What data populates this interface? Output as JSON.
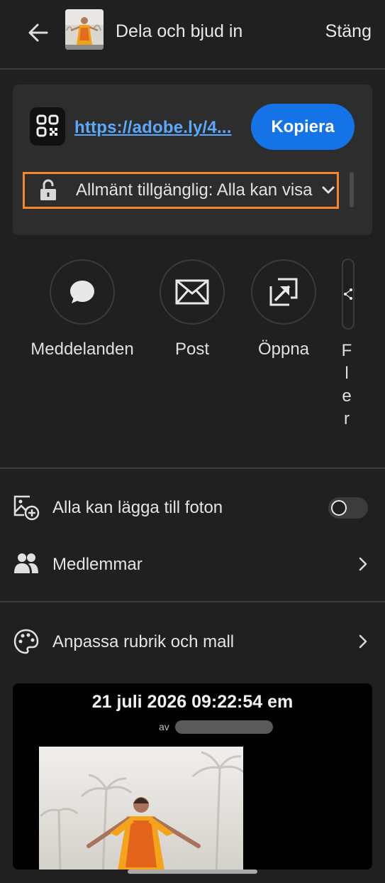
{
  "header": {
    "title": "Dela och bjud in",
    "close_label": "Stäng"
  },
  "link_card": {
    "url": "https://adobe.ly/4...",
    "copy_label": "Kopiera",
    "access_label": "Allmänt tillgänglig: Alla kan visa"
  },
  "share_targets": [
    {
      "label": "Meddelanden",
      "icon": "message-bubble-icon"
    },
    {
      "label": "Post",
      "icon": "mail-icon"
    },
    {
      "label": "Öppna",
      "icon": "open-external-icon"
    },
    {
      "label": "Fler",
      "icon": "share-icon"
    }
  ],
  "settings": {
    "allow_add_photos_label": "Alla kan lägga till foton",
    "allow_add_photos_on": false,
    "members_label": "Medlemmar",
    "customize_label": "Anpassa rubrik och mall"
  },
  "preview": {
    "date_title": "21 juli 2026 09:22:54 em",
    "by_label": "av"
  },
  "colors": {
    "background": "#202020",
    "card": "#2d2d2d",
    "accent_blue": "#1473e6",
    "link_blue": "#5aa9ff",
    "highlight_orange": "#f5852a"
  }
}
